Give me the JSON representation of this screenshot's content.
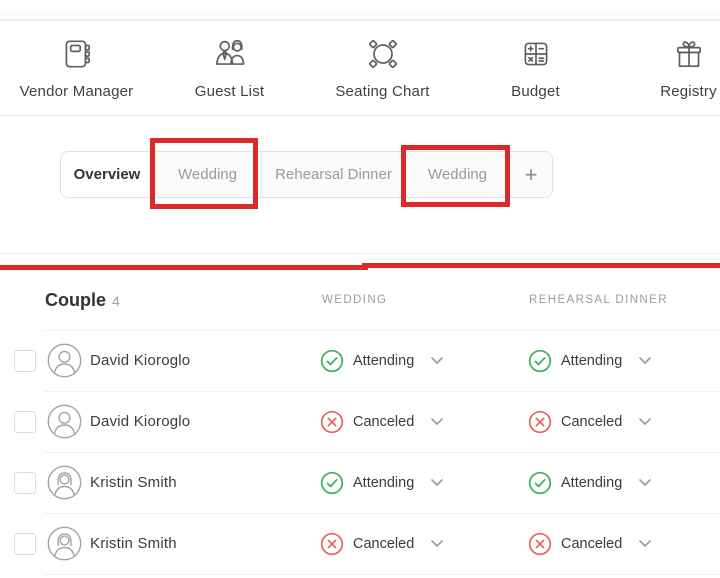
{
  "nav": {
    "items": [
      {
        "label": "Vendor Manager",
        "icon": "address-book-icon",
        "active": false
      },
      {
        "label": "Guest List",
        "icon": "couple-icon",
        "active": true
      },
      {
        "label": "Seating Chart",
        "icon": "round-table-icon",
        "active": false
      },
      {
        "label": "Budget",
        "icon": "calculator-icon",
        "active": false
      },
      {
        "label": "Registry",
        "icon": "gift-icon",
        "active": false
      }
    ]
  },
  "tabs": {
    "items": [
      {
        "label": "Overview",
        "active": true,
        "annotated": false
      },
      {
        "label": "Wedding",
        "active": false,
        "annotated": true
      },
      {
        "label": "Rehearsal Dinner",
        "active": false,
        "annotated": false
      },
      {
        "label": "Wedding",
        "active": false,
        "annotated": true
      },
      {
        "label": "+",
        "active": false,
        "annotated": false
      }
    ]
  },
  "annotations": {
    "boxes": [
      "first-wedding-tab",
      "second-wedding-tab"
    ],
    "line": "full-width-red-underline"
  },
  "table": {
    "header": {
      "couple_label": "Couple",
      "couple_count": "4",
      "col_wedding": "WEDDING",
      "col_rehearsal": "REHEARSAL DINNER"
    },
    "rows": [
      {
        "name": "David Kioroglo",
        "avatar": "male",
        "wedding_status": "Attending",
        "rehearsal_status": "Attending"
      },
      {
        "name": "David Kioroglo",
        "avatar": "male",
        "wedding_status": "Canceled",
        "rehearsal_status": "Canceled"
      },
      {
        "name": "Kristin Smith",
        "avatar": "female",
        "wedding_status": "Attending",
        "rehearsal_status": "Attending"
      },
      {
        "name": "Kristin Smith",
        "avatar": "female",
        "wedding_status": "Canceled",
        "rehearsal_status": "Canceled"
      }
    ]
  },
  "colors": {
    "active_tab_underline": "#2ba8a2",
    "attending": "#3ead5b",
    "canceled": "#e4635d",
    "annotation_highlight": "#db2828"
  }
}
